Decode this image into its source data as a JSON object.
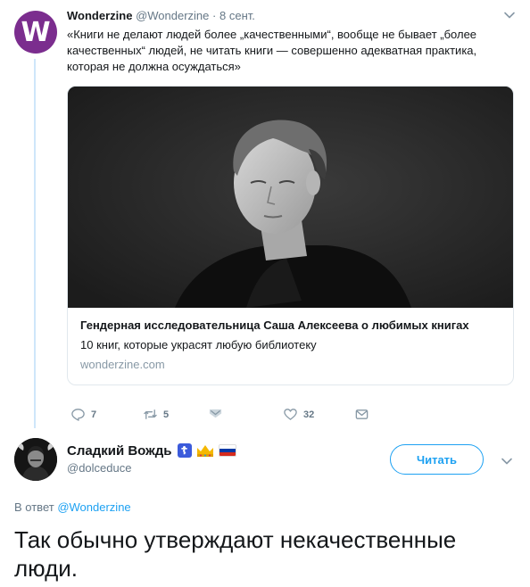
{
  "quoted_tweet": {
    "avatar_letter": "W",
    "author_name": "Wonderzine",
    "author_handle": "@Wonderzine",
    "separator": "·",
    "date": "8 сент.",
    "text": "«Книги не делают людей более „качественными“, вообще не бывает „более качественных“ людей, не читать книги — совершенно адекватная практика, которая не должна осуждаться»",
    "card": {
      "title": "Гендерная исследовательница Саша Алексеева о любимых книгах",
      "description": "10 книг, которые украсят любую библиотеку",
      "domain": "wonderzine.com"
    },
    "actions": {
      "replies": "7",
      "retweets": "5",
      "likes": "32"
    },
    "icons": [
      "reply-icon",
      "retweet-icon",
      "direct-message-icon",
      "like-icon",
      "mail-icon",
      "chevron-down-icon"
    ]
  },
  "reply_tweet": {
    "author_name": "Сладкий Вождь",
    "author_handle": "@dolceduce",
    "follow_label": "Читать",
    "reply_prefix": "В ответ",
    "reply_target": "@Wonderzine",
    "text": "Так обычно утверждают некачественные люди.",
    "name_emoji": [
      "orthodox-cross-icon",
      "crown-icon",
      "russia-flag-icon"
    ]
  },
  "colors": {
    "accent": "#1da1f2",
    "wonderzine_purple": "#7b2d8e",
    "muted": "#657786",
    "thread_line": "#cfe6fa"
  }
}
